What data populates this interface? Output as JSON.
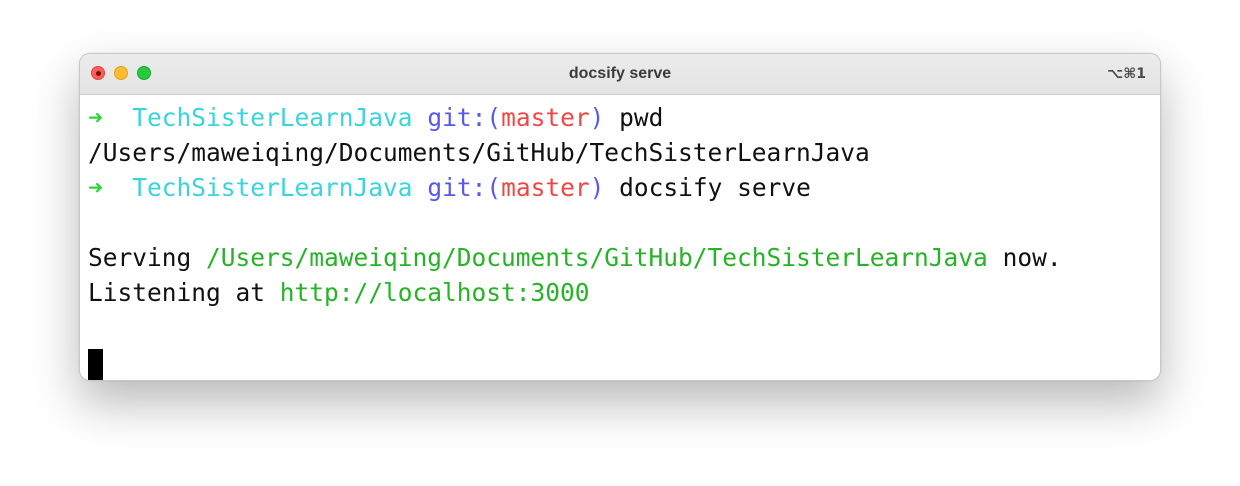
{
  "window": {
    "title": "docsify serve",
    "shortcut": "⌥⌘1"
  },
  "colors": {
    "prompt_arrow": "#2fd43d",
    "directory": "#3ad4de",
    "git_label": "#5858f0",
    "branch": "#f24646",
    "highlight_path": "#26b426"
  },
  "terminal": {
    "lines": [
      {
        "arrow": "➜",
        "dir": "TechSisterLearnJava",
        "git_open": "git:(",
        "branch": "master",
        "git_close": ")",
        "command": "pwd"
      },
      {
        "text": "/Users/maweiqing/Documents/GitHub/TechSisterLearnJava"
      },
      {
        "arrow": "➜",
        "dir": "TechSisterLearnJava",
        "git_open": "git:(",
        "branch": "master",
        "git_close": ")",
        "command": "docsify serve"
      },
      {
        "text": ""
      },
      {
        "prefix": "Serving",
        "path": "/Users/maweiqing/Documents/GitHub/TechSisterLearnJava",
        "suffix": "now."
      },
      {
        "prefix": "Listening at",
        "path": "http://localhost:3000"
      }
    ]
  }
}
